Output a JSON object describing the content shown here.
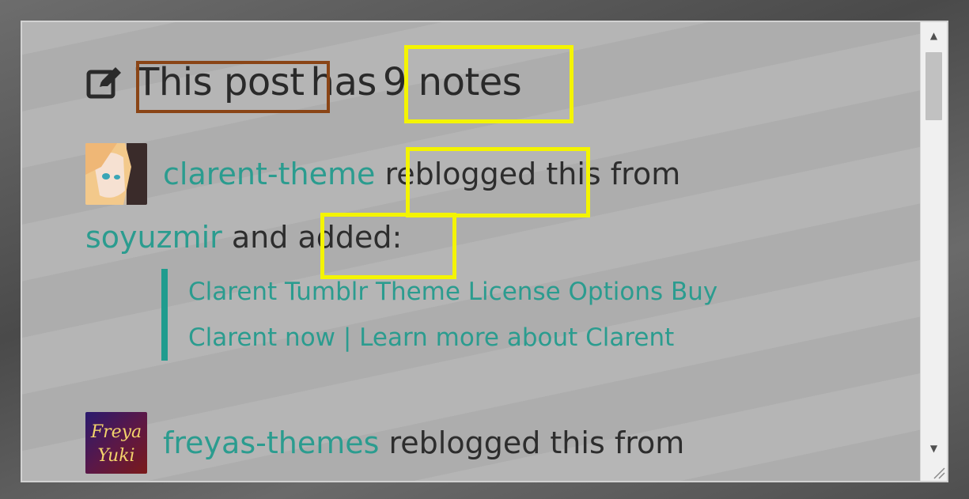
{
  "heading": {
    "prefix": "This post",
    "middle": "has",
    "count": "9 notes",
    "icon": "edit-icon"
  },
  "notes": [
    {
      "user": "clarent-theme",
      "action": "reblogged",
      "text_after": "this from",
      "source": "soyuzmir",
      "conj": "and",
      "added": "added:",
      "quote_lines": [
        "Clarent Tumblr Theme License Options Buy",
        "Clarent now | Learn more about Clarent"
      ]
    },
    {
      "user": "freyas-themes",
      "action": "reblogged this from"
    }
  ],
  "avatars": {
    "second_text_top": "Freya",
    "second_text_bottom": "Yuki"
  },
  "colors": {
    "link": "#2b9c8f",
    "quote_bar": "#1f9c8e",
    "highlight_yellow": "#f4f400",
    "highlight_brown": "#8a4516",
    "panel_bg": "#adadad"
  }
}
